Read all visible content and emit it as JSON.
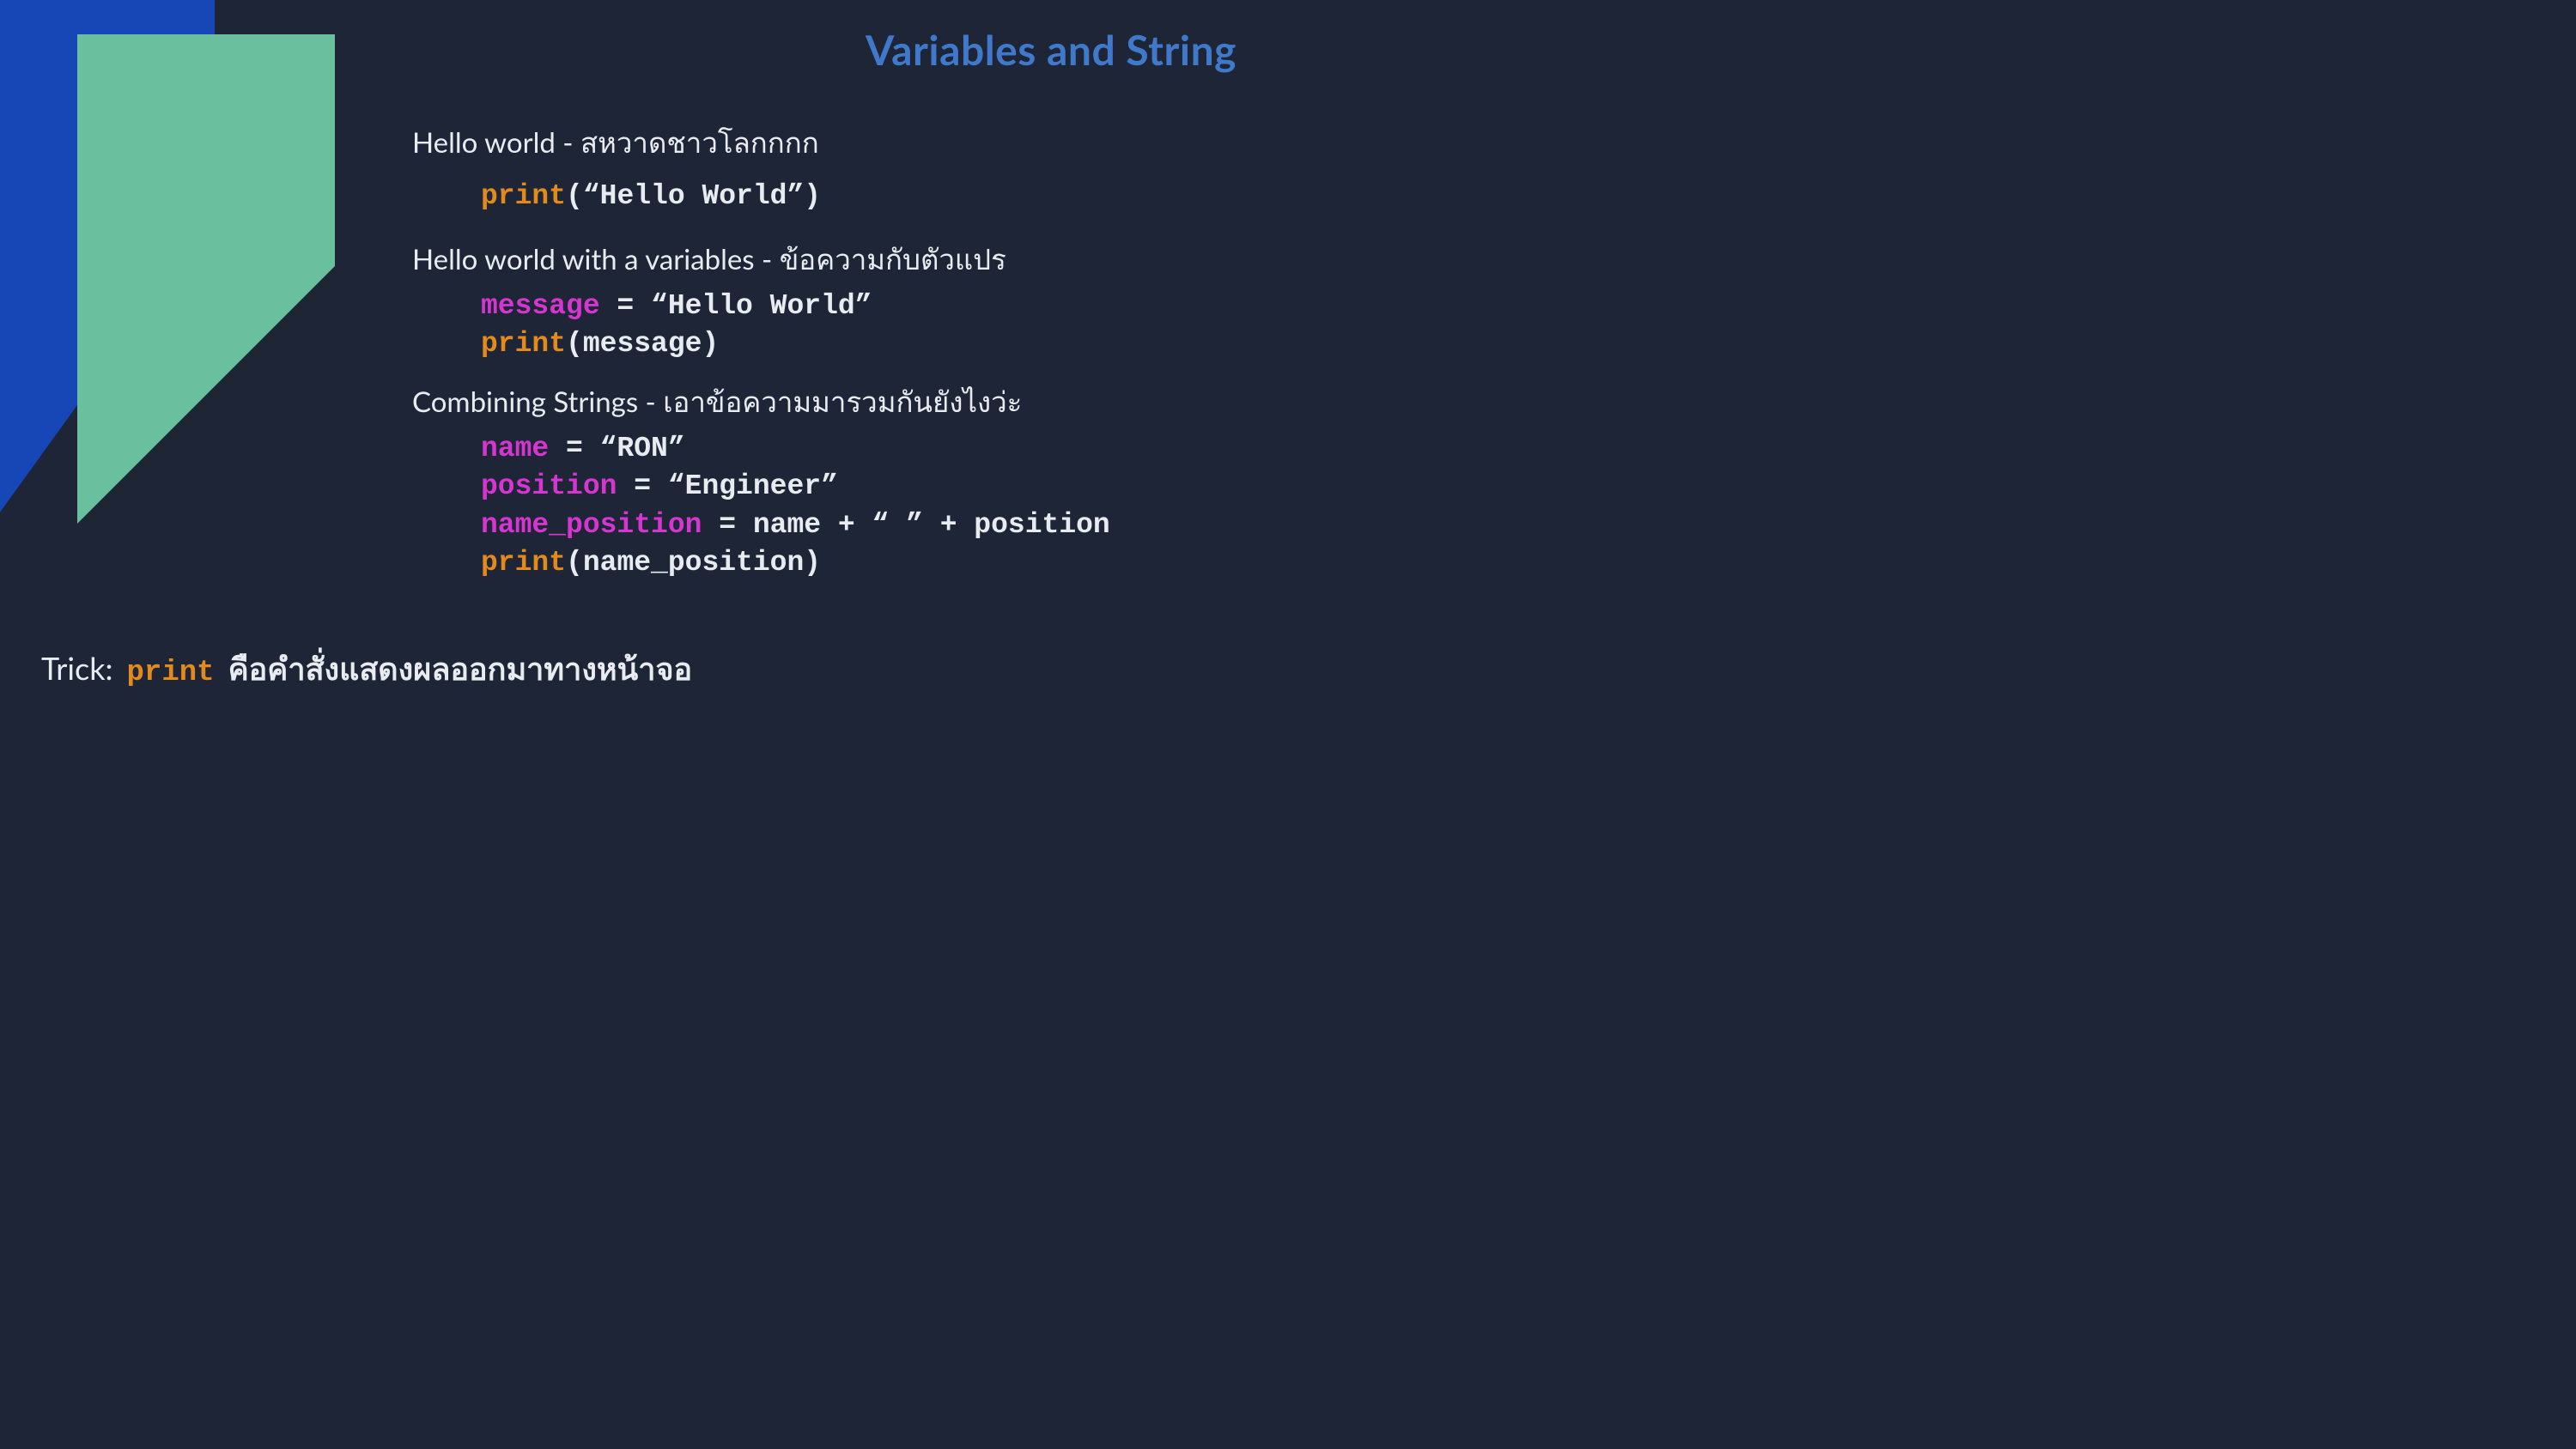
{
  "title": "Variables and String",
  "sections": {
    "s0": {
      "heading": "Hello world - สหวาดชาวโลกกกก",
      "code": {
        "l0": {
          "kw": "print",
          "rest": "(“Hello World”)"
        }
      }
    },
    "s1": {
      "heading": "Hello world with a variables - ข้อความกับตัวแปร",
      "code": {
        "l0": {
          "kw": "message",
          "rest": " = “Hello World”"
        },
        "l1": {
          "kw": "print",
          "rest": "(message)"
        }
      }
    },
    "s2": {
      "heading": "Combining Strings - เอาข้อความมารวมกันยังไงว่ะ",
      "code": {
        "l0": {
          "kw": "name",
          "rest": " = “RON”"
        },
        "l1": {
          "kw": "position",
          "rest": " = “Engineer”"
        },
        "l2": {
          "kw": "name_position",
          "rest": " = name + “ ” + position"
        },
        "l3": {
          "kw": "print",
          "rest": "(name_position)"
        }
      }
    }
  },
  "trick": {
    "label": "Trick:",
    "keyword": "print",
    "desc": "คือคำสั่งแสดงผลออกมาทางหน้าจอ"
  },
  "colors": {
    "bg": "#1d2536",
    "accent_blue": "#4079c9",
    "shape_blue": "#1747b6",
    "shape_teal": "#6abf9e",
    "kw_orange": "#e38a1c",
    "kw_pink": "#d536d0",
    "text": "#e8ecf1"
  }
}
